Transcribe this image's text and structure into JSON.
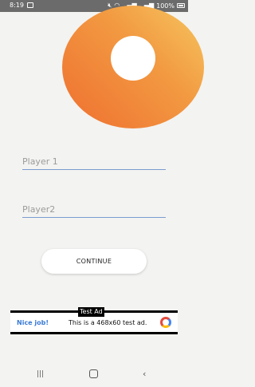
{
  "status_bar": {
    "time": "8:19",
    "icons": [
      "image-icon",
      "mute-icon",
      "wifi-icon",
      "signal-icon",
      "signal-icon",
      "battery-icon"
    ],
    "battery": "100%"
  },
  "hero": {
    "accent_color": "#ef6f2f",
    "accent_light": "#f6c760"
  },
  "form": {
    "player1": {
      "placeholder": "Player 1",
      "value": ""
    },
    "player2": {
      "placeholder": "Player2",
      "value": ""
    },
    "continue_label": "CONTINUE"
  },
  "ad": {
    "label": "Test Ad",
    "nice": "Nice job!",
    "text": "This is a 468x60 test ad."
  },
  "nav": {
    "recents_glyph": "|||",
    "back_glyph": "‹"
  }
}
